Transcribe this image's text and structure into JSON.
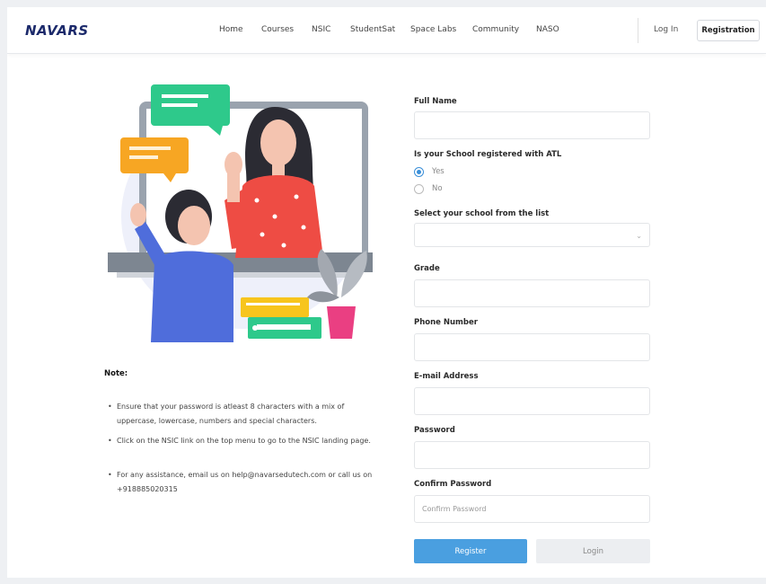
{
  "header": {
    "logo_text": "NAVARS",
    "nav": [
      {
        "label": "Home"
      },
      {
        "label": "Courses"
      },
      {
        "label": "NSIC"
      },
      {
        "label": "StudentSat"
      },
      {
        "label": "Space Labs"
      },
      {
        "label": "Community"
      },
      {
        "label": "NASO"
      }
    ],
    "login_label": "Log In",
    "registration_label": "Registration"
  },
  "note": {
    "title": "Note:",
    "items": [
      "Ensure that your password is atleast 8 characters with a mix of uppercase, lowercase, numbers and special characters.",
      "Click on the NSIC link on the top menu to go to the NSIC landing page.",
      "For any assistance, email us on help@navarsedutech.com or call us on +918885020315"
    ]
  },
  "form": {
    "full_name": {
      "label": "Full Name",
      "value": "",
      "placeholder": ""
    },
    "atl": {
      "label": "Is your School registered with ATL",
      "options": [
        {
          "label": "Yes",
          "selected": true
        },
        {
          "label": "No",
          "selected": false
        }
      ]
    },
    "school": {
      "label": "Select your school from the list",
      "value": ""
    },
    "grade": {
      "label": "Grade",
      "value": ""
    },
    "phone": {
      "label": "Phone Number",
      "value": ""
    },
    "email": {
      "label": "E-mail Address",
      "value": ""
    },
    "password": {
      "label": "Password",
      "value": ""
    },
    "confirm_password": {
      "label": "Confirm Password",
      "placeholder": "Confirm Password"
    },
    "register_label": "Register",
    "login_label": "Login"
  },
  "colors": {
    "brand": "#1c2a6b",
    "primary_button": "#4a9fe0",
    "secondary_button": "#eceef1",
    "radio_active": "#3a8fd8"
  }
}
